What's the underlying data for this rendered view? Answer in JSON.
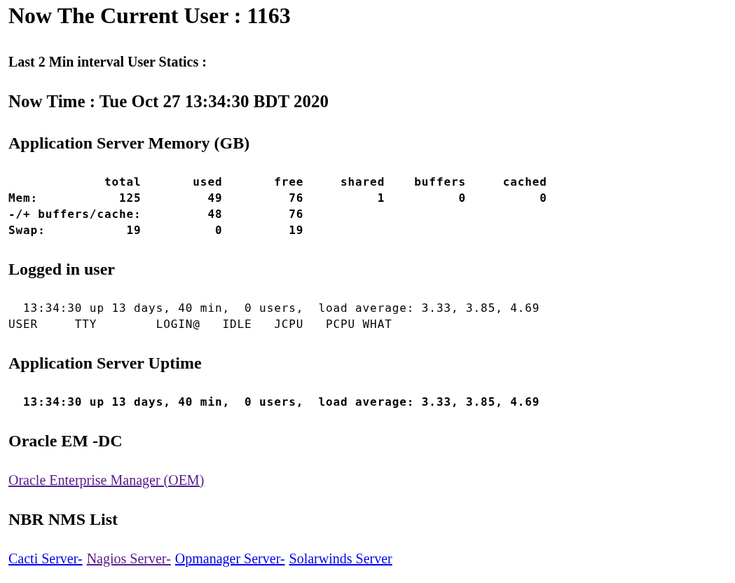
{
  "sections": [
    {
      "kind": "title",
      "text": "Now The Current User : 1163"
    },
    {
      "kind": "subheading",
      "text": "Last 2 Min interval User Statics :"
    },
    {
      "kind": "time",
      "text": "Now Time : Tue Oct 27 13:34:30 BDT 2020"
    },
    {
      "kind": "heading",
      "text": "Application Server Memory (GB)"
    },
    {
      "kind": "pre",
      "bold": true,
      "lines": [
        "             total       used       free     shared    buffers     cached",
        "Mem:           125         49         76          1          0          0",
        "-/+ buffers/cache:         48         76",
        "Swap:           19          0         19"
      ]
    },
    {
      "kind": "heading",
      "text": "Logged in user"
    },
    {
      "kind": "pre",
      "bold": false,
      "lines": [
        "  13:34:30 up 13 days, 40 min,  0 users,  load average: 3.33, 3.85, 4.69",
        "USER     TTY        LOGIN@   IDLE   JCPU   PCPU WHAT"
      ]
    },
    {
      "kind": "heading",
      "text": "Application Server Uptime"
    },
    {
      "kind": "pre",
      "bold": true,
      "lines": [
        "  13:34:30 up 13 days, 40 min,  0 users,  load average: 3.33, 3.85, 4.69"
      ]
    },
    {
      "kind": "heading",
      "text": "Oracle EM -DC"
    },
    {
      "kind": "links",
      "links": [
        {
          "text": "Oracle Enterprise Manager (OEM)",
          "visited": true
        }
      ]
    },
    {
      "kind": "heading",
      "text": "NBR NMS List"
    },
    {
      "kind": "links",
      "links": [
        {
          "text": "Cacti Server-",
          "visited": false
        },
        {
          "text": "Nagios Server-",
          "visited": true
        },
        {
          "text": "Opmanager Server-",
          "visited": false
        },
        {
          "text": "Solarwinds Server",
          "visited": false
        }
      ]
    }
  ]
}
